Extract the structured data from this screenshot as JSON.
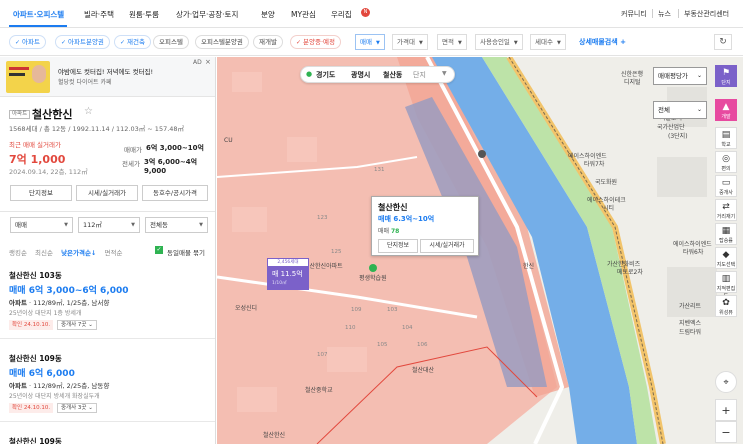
{
  "topnav": {
    "items": [
      "아파트·오피스텔",
      "빌라·주택",
      "원룸·투룸",
      "상가·업무·공장·토지",
      "분양",
      "MY관심",
      "우리집"
    ],
    "new_badge": "N",
    "right": [
      "커뮤니티",
      "뉴스",
      "부동산관리센터"
    ]
  },
  "filters": {
    "chips": [
      "아파트",
      "아파트분양권",
      "재건축",
      "오피스텔",
      "오피스텔분양권",
      "재개발",
      "분양중·예정"
    ],
    "dropdowns": [
      "매매",
      "가격대",
      "면적",
      "사용승인일",
      "세대수"
    ],
    "detail_search": "상세매물검색",
    "plus": "+"
  },
  "ad": {
    "line1": "야밤에도 컷터집! 저녁에도 컷터집!",
    "line2": "혈당컷 다이어트 카페",
    "tag": "AD",
    "close": "×"
  },
  "complex": {
    "type_tag": "아파트",
    "name": "철산한신",
    "star": "☆",
    "spec": "1568세대 / 총 12동 / 1992.11.14 / 112.03㎡ ~ 157.48㎡",
    "recent_label": "최근 매매 실거래가",
    "recent_price": "7억 1,000",
    "recent_date": "2024.09.14, 22층, 112㎡",
    "sale_label": "매매가",
    "sale_range": "6억 3,000~10억",
    "jeonse_label": "전세가",
    "jeonse_range": "3억 6,000~4억 9,000",
    "buttons": [
      "단지정보",
      "시세/실거래가",
      "동호수/공시가격"
    ]
  },
  "selects": [
    "매매",
    "112㎡",
    "전체동"
  ],
  "sort": {
    "items": [
      "랭킹순",
      "최신순",
      "낮은가격순↓",
      "면적순"
    ],
    "same_check": "✓",
    "same_label": "동일매물 묶기"
  },
  "listings": [
    {
      "title": "철산한신 103동",
      "price": "매매 6억 3,000~6억 6,000",
      "type": "아파트",
      "spec": " · 112/89㎡, 1/25층, 남서향",
      "desc": "25년이상   대단지   1층   방세개",
      "confirm": "확인 24.10.10.",
      "agent": "중개사 7곳 ⌄"
    },
    {
      "title": "철산한신 109동",
      "price": "매매 6억 6,000",
      "type": "아파트",
      "spec": " · 112/89㎡, 2/25층, 남동향",
      "desc": "25년이상   대단지   방세개   화장실두개",
      "confirm": "확인 24.10.10.",
      "agent": "중개사 3곳 ⌄"
    },
    {
      "title": "철산한신 109동",
      "price": "",
      "type": "",
      "spec": "",
      "desc": "",
      "confirm": "",
      "agent": ""
    }
  ],
  "map": {
    "breadcrumb": [
      "경기도",
      "광명시",
      "철산동",
      "단지"
    ],
    "popup": {
      "title": "철산한신",
      "price": "매매 6.3억~10억",
      "jeonse_label": "매매",
      "jeonse_value": "78",
      "btn1": "단지정보",
      "btn2": "시세/실거래가"
    },
    "marker": {
      "top": "2,456세대",
      "value": "매 11.5억",
      "count": "1/10㎡"
    },
    "sel1": "매매평당가",
    "sel2": "전체",
    "tools": [
      {
        "icon": "⚑",
        "label": "단지"
      },
      {
        "icon": "▲",
        "label": "개발"
      },
      {
        "icon": "▤",
        "label": "학교"
      },
      {
        "icon": "◎",
        "label": "편의"
      },
      {
        "icon": "▭",
        "label": "중개사"
      },
      {
        "icon": "⇄",
        "label": "거리재기"
      },
      {
        "icon": "▦",
        "label": "탑승률"
      },
      {
        "icon": "◆",
        "label": "지도선택"
      },
      {
        "icon": "▥",
        "label": "지적편집도"
      },
      {
        "icon": "✿",
        "label": "위성뷰"
      }
    ],
    "pois": [
      "신한은행",
      "디지털",
      "매매평당가",
      "서울도시",
      "국가산업단",
      "(3단지)",
      "에이스하이엔드",
      "타워7차",
      "국도화원",
      "에이스하이테크",
      "시티",
      "한신",
      "철산한신아파트",
      "평생학습원",
      "에이스하이엔드",
      "타워6차",
      "가산한화비즈",
      "메트로2차",
      "가산리트",
      "지벤엑스",
      "드림타워",
      "명덕",
      "가산디지털단",
      "오성신디",
      "철산두산위브",
      "철산대산",
      "철산코오롱",
      "철산중학교",
      "철산한신",
      "연서초등",
      "CU"
    ],
    "numbers": [
      "123",
      "125",
      "131",
      "109",
      "110",
      "103",
      "104",
      "105",
      "106",
      "107",
      "108",
      "113",
      "114",
      "115",
      "116",
      "117",
      "118",
      "102",
      "101",
      "112",
      "111",
      "101",
      "102",
      "103",
      "104"
    ]
  }
}
